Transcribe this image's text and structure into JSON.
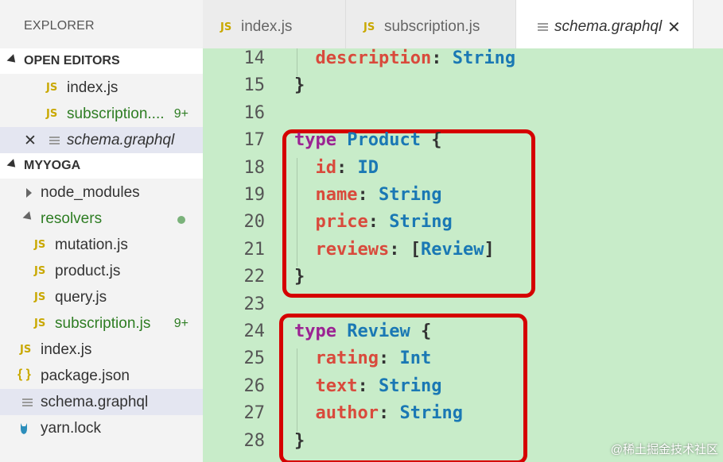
{
  "sidebar": {
    "title": "EXPLORER",
    "open_editors": {
      "header": "OPEN EDITORS",
      "items": [
        {
          "label": "index.js",
          "icon": "JS"
        },
        {
          "label": "subscription....",
          "icon": "JS",
          "badge": "9+"
        },
        {
          "label": "schema.graphql",
          "close": "✕"
        }
      ]
    },
    "project": {
      "header": "MYYOGA",
      "items": [
        {
          "label": "node_modules"
        },
        {
          "label": "resolvers"
        },
        {
          "label": "mutation.js",
          "icon": "JS"
        },
        {
          "label": "product.js",
          "icon": "JS"
        },
        {
          "label": "query.js",
          "icon": "JS"
        },
        {
          "label": "subscription.js",
          "icon": "JS",
          "badge": "9+"
        },
        {
          "label": "index.js",
          "icon": "JS"
        },
        {
          "label": "package.json",
          "icon": "{ }"
        },
        {
          "label": "schema.graphql"
        },
        {
          "label": "yarn.lock"
        }
      ]
    }
  },
  "tabs": [
    {
      "label": "index.js",
      "icon": "JS"
    },
    {
      "label": "subscription.js",
      "icon": "JS"
    },
    {
      "label": "schema.graphql",
      "close": "✕"
    }
  ],
  "editor": {
    "lines": [
      {
        "num": "14",
        "code": "  description: String"
      },
      {
        "num": "15",
        "code": "}"
      },
      {
        "num": "16",
        "code": ""
      },
      {
        "num": "17",
        "code": "type Product {"
      },
      {
        "num": "18",
        "code": "  id: ID"
      },
      {
        "num": "19",
        "code": "  name: String"
      },
      {
        "num": "20",
        "code": "  price: String"
      },
      {
        "num": "21",
        "code": "  reviews: [Review]"
      },
      {
        "num": "22",
        "code": "}"
      },
      {
        "num": "23",
        "code": ""
      },
      {
        "num": "24",
        "code": "type Review {"
      },
      {
        "num": "25",
        "code": "  rating: Int"
      },
      {
        "num": "26",
        "code": "  text: String"
      },
      {
        "num": "27",
        "code": "  author: String"
      },
      {
        "num": "28",
        "code": "}"
      }
    ]
  },
  "watermark": "@稀土掘金技术社区",
  "colors": {
    "editor_bg": "#c8ecc9",
    "keyword": "#9b2393",
    "type": "#1a78b4",
    "field": "#d94a3c",
    "highlight_box": "#d50000",
    "modified": "#2e7d23"
  }
}
